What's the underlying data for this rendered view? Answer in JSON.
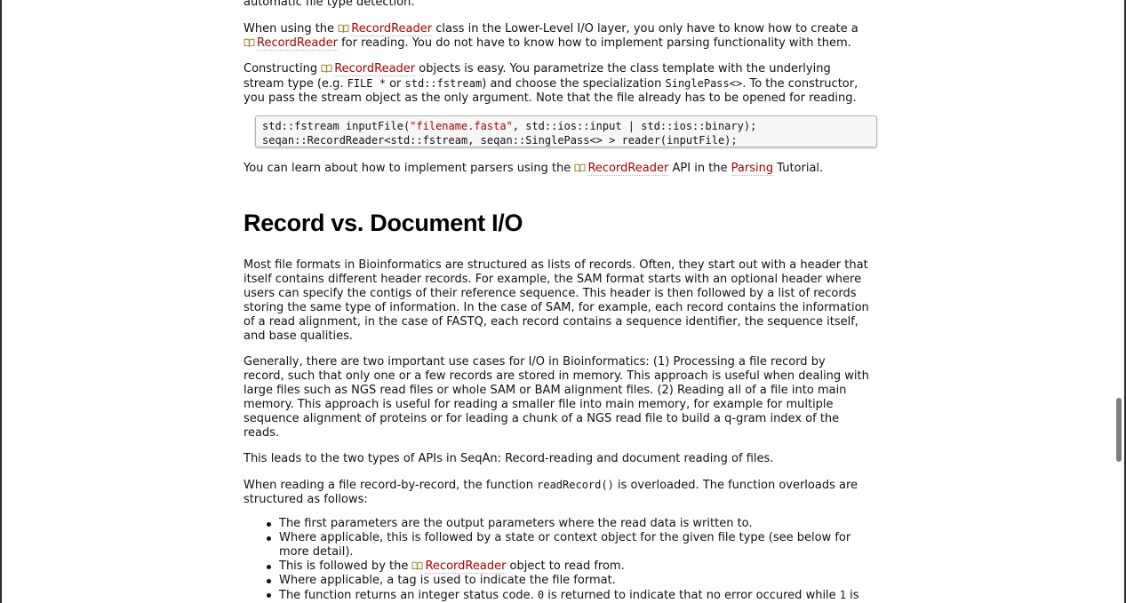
{
  "intro_fragment": "automatic file type detection.",
  "p1": {
    "a": "When using the ",
    "link1": "RecordReader",
    "b": " class in the Lower-Level I/O layer, you only have to know how to create a",
    "link2": "RecordReader",
    "c": " for reading. You do not have to know how to implement parsing functionality with them."
  },
  "p2": {
    "a": "Constructing ",
    "link1": "RecordReader",
    "b": " objects is easy. You parametrize the class template with the underlying",
    "c": "stream type (e.g. ",
    "code1": "FILE *",
    "d": " or ",
    "code2": "std::fstream",
    "e": ") and choose the specialization ",
    "code3": "SinglePass<>",
    "f": ". To the constructor,",
    "g": "you pass the stream object as the only argument. Note that the file already has to be opened for reading."
  },
  "code": {
    "l1a": "std::fstream inputFile(",
    "l1str": "\"filename.fasta\"",
    "l1b": ", std::ios::input | std::ios::binary);",
    "l2": "seqan::RecordReader<std::fstream, seqan::SinglePass<> > reader(inputFile);"
  },
  "p3": {
    "a": "You can learn about how to implement parsers using the ",
    "link1": "RecordReader",
    "b": " API in the ",
    "link2": "Parsing",
    "c": " Tutorial."
  },
  "heading": "Record vs. Document I/O",
  "p4": [
    "Most file formats in Bioinformatics are structured as lists of records. Often, they start out with a header that",
    "itself contains different header records. For example, the SAM format starts with an optional header where",
    "users can specify the contigs of their reference sequence. This header is then followed by a list of records",
    "storing the same type of information. In the case of SAM, for example, each record contains the information",
    "of a read alignment, in the case of FASTQ, each record contains a sequence identifier, the sequence itself,",
    "and base qualities."
  ],
  "p5": [
    "Generally, there are two important use cases for I/O in Bioinformatics: (1) Processing a file record by",
    "record, such that only one or a few records are stored in memory. This approach is useful when dealing with",
    "large files such as NGS read files or whole SAM or BAM alignment files. (2) Reading all of a file into main",
    "memory. This approach is useful for reading a smaller file into main memory, for example for multiple",
    "sequence alignment of proteins or for leading a chunk of a NGS read file to build a q-gram index of the",
    "reads."
  ],
  "p6": "This leads to the two types of APIs in SeqAn: Record-reading and document reading of files.",
  "p7": {
    "a": "When reading a file record-by-record, the function ",
    "code1": "readRecord()",
    "b": " is overloaded. The function overloads are",
    "c": "structured as follows:"
  },
  "bullets": {
    "b1": "The first parameters are the output parameters where the read data is written to.",
    "b2a": "Where applicable, this is followed by a state or context object for the given file type (see below for",
    "b2b": "more detail).",
    "b3a": "This is followed by the ",
    "b3link": "RecordReader",
    "b3b": " object to read from.",
    "b4": "Where applicable, a tag is used to indicate the file format.",
    "b5a": "The function returns an integer status code. ",
    "b5c1": "0",
    "b5b": " is returned to indicate that no error occured while ",
    "b5c2": "1",
    "b5c": " is"
  },
  "colors": {
    "link": "#a40000",
    "heading": "#000000"
  }
}
